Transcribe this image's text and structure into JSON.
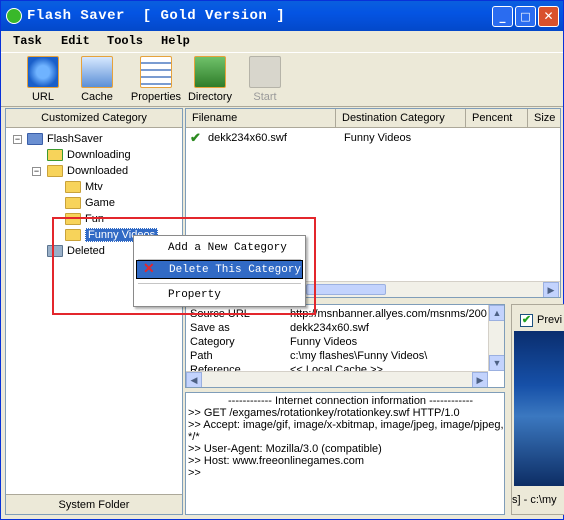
{
  "window": {
    "title": "Flash Saver  [ Gold Version ]",
    "min_glyph": "_",
    "max_glyph": "□",
    "close_glyph": "✕"
  },
  "menu": {
    "items": [
      {
        "label": "Task",
        "underline": "T"
      },
      {
        "label": "Edit",
        "underline": "E"
      },
      {
        "label": "Tools",
        "underline": "o"
      },
      {
        "label": "Help",
        "underline": "H"
      }
    ]
  },
  "toolbar": {
    "buttons": [
      {
        "label": "URL",
        "icon": "ie-icon",
        "enabled": true
      },
      {
        "label": "Cache",
        "icon": "cache-icon",
        "enabled": true
      },
      {
        "label": "Properties",
        "icon": "properties-icon",
        "enabled": true
      },
      {
        "label": "Directory",
        "icon": "directory-icon",
        "enabled": true
      },
      {
        "label": "Start",
        "icon": "start-icon",
        "enabled": false
      }
    ]
  },
  "left_panel": {
    "header": "Customized Category",
    "footer": "System Folder",
    "tree": {
      "root": "FlashSaver",
      "downloading": "Downloading",
      "downloaded": "Downloaded",
      "categories": [
        "Mtv",
        "Game",
        "Fun",
        "Funny Videos"
      ],
      "deleted": "Deleted",
      "expand_minus": "−"
    }
  },
  "file_list": {
    "columns": [
      "Filename",
      "Destination Category",
      "Pencent",
      "Size"
    ],
    "rows": [
      {
        "check": "✔",
        "filename": "dekk234x60.swf",
        "destination": "Funny Videos"
      }
    ]
  },
  "properties": {
    "rows": [
      {
        "key": "Source URL",
        "value": "http://msnbanner.allyes.com/msnms/200"
      },
      {
        "key": "Save as",
        "value": "dekk234x60.swf"
      },
      {
        "key": "Category",
        "value": "Funny Videos"
      },
      {
        "key": "Path",
        "value": "c:\\my flashes\\Funny Videos\\"
      },
      {
        "key": "Reference",
        "value": "<< Local Cache >>"
      }
    ]
  },
  "log": {
    "lines": [
      "------------  Internet connection information  ------------",
      ">> GET /exgames/rotationkey/rotationkey.swf HTTP/1.0",
      ">> Accept: image/gif, image/x-xbitmap, image/jpeg, image/pjpeg,",
      "*/*",
      ">> User-Agent: Mozilla/3.0 (compatible)",
      ">> Host: www.freeonlinegames.com",
      ">>"
    ]
  },
  "preview": {
    "checkbox_label": "Previ",
    "checked": true,
    "path_text": "s] - c:\\my"
  },
  "context_menu": {
    "items": [
      {
        "label": "Add a New Category",
        "highlighted": false
      },
      {
        "label": "Delete This Category",
        "highlighted": true
      },
      {
        "label": "Property",
        "highlighted": false
      }
    ],
    "delete_icon": "✕"
  },
  "colors": {
    "title_bar": "#0454e3",
    "selection": "#316ac5",
    "annotation_box": "#e3262c",
    "check": "#2b8a1f"
  }
}
